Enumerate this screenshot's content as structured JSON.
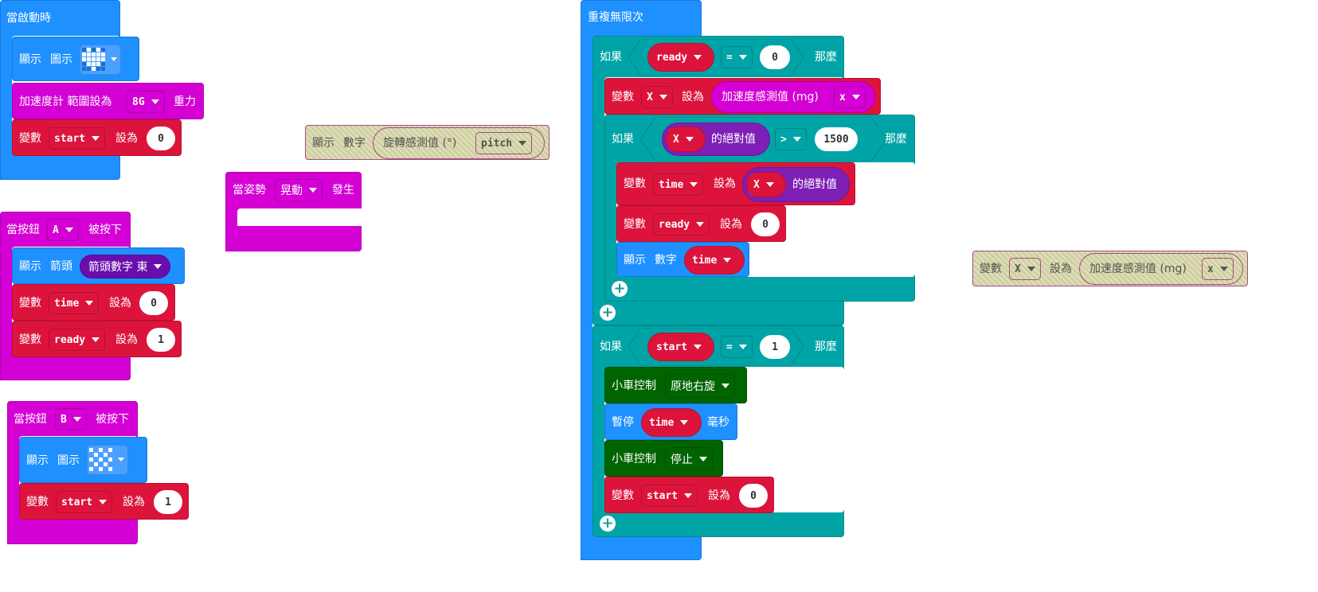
{
  "colors": {
    "loops": "#1e90ff",
    "motion_purple": "#d400d4",
    "variables": "#dc143c",
    "logic": "#00a4a6",
    "math": "#7e1fb5",
    "car": "#006400",
    "arrow": "#6a0dad",
    "disabled": "#cfcf9f"
  },
  "on_start": {
    "title": "當啟動時",
    "show_icon": {
      "show": "顯示",
      "icon": "圖示",
      "icon_name": "heart-icon"
    },
    "accel": {
      "label": "加速度計 範圍設為",
      "value": "8G",
      "unit": "重力"
    },
    "set_var": {
      "var": "變數",
      "name": "start",
      "set": "設為",
      "value": "0"
    }
  },
  "button_a": {
    "title_pre": "當按鈕",
    "button": "A",
    "title_post": "被按下",
    "show_arrow": {
      "show": "顯示",
      "arrow": "箭頭",
      "dir_label": "箭頭數字 東"
    },
    "set_time": {
      "var": "變數",
      "name": "time",
      "set": "設為",
      "value": "0"
    },
    "set_ready": {
      "var": "變數",
      "name": "ready",
      "set": "設為",
      "value": "1"
    }
  },
  "button_b": {
    "title_pre": "當按鈕",
    "button": "B",
    "title_post": "被按下",
    "show_icon": {
      "show": "顯示",
      "icon": "圖示",
      "icon_name": "pattern-icon"
    },
    "set_start": {
      "var": "變數",
      "name": "start",
      "set": "設為",
      "value": "1"
    }
  },
  "show_number_pitch": {
    "show": "顯示",
    "number": "數字",
    "sensor": "旋轉感測值 (°)",
    "axis": "pitch"
  },
  "gesture": {
    "pre": "當姿勢",
    "gesture": "晃動",
    "post": "發生"
  },
  "forever": {
    "title": "重複無限次",
    "if1": {
      "if": "如果",
      "var": "ready",
      "op": "=",
      "value": "0",
      "then": "那麼",
      "set_x": {
        "var": "變數",
        "name": "X",
        "set": "設為",
        "sensor": "加速度感測值 (mg)",
        "axis": "x"
      },
      "if2": {
        "if": "如果",
        "var": "X",
        "abs": "的絕對值",
        "op": ">",
        "value": "1500",
        "then": "那麼",
        "set_time": {
          "var": "變數",
          "name": "time",
          "set": "設為",
          "abs_var": "X",
          "abs": "的絕對值"
        },
        "set_ready": {
          "var": "變數",
          "name": "ready",
          "set": "設為",
          "value": "0"
        },
        "show_time": {
          "show": "顯示",
          "number": "數字",
          "var": "time"
        }
      }
    },
    "if3": {
      "if": "如果",
      "var": "start",
      "op": "=",
      "value": "1",
      "then": "那麼",
      "car1": {
        "label": "小車控制",
        "action": "原地右旋"
      },
      "pause": {
        "label": "暫停",
        "var": "time",
        "unit": "毫秒"
      },
      "car2": {
        "label": "小車控制",
        "action": "停止"
      },
      "set_start": {
        "var": "變數",
        "name": "start",
        "set": "設為",
        "value": "0"
      }
    }
  },
  "disabled_set_x": {
    "var": "變數",
    "name": "X",
    "set": "設為",
    "sensor": "加速度感測值 (mg)",
    "axis": "x"
  }
}
